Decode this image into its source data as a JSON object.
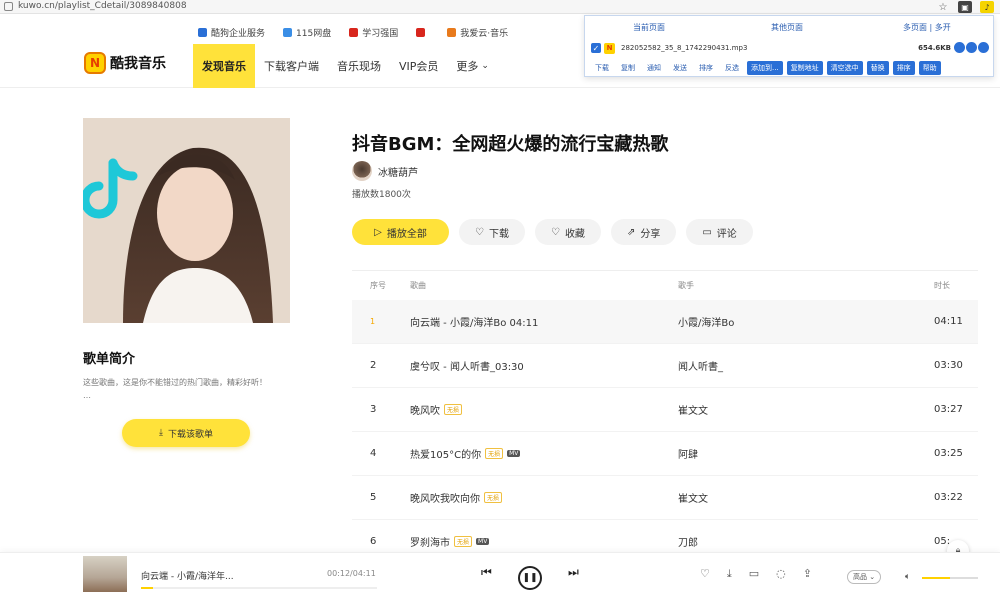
{
  "browser": {
    "url": "kuwo.cn/playlist_Cdetail/3089840808"
  },
  "bookmarks": [
    {
      "label": "酷狗企业服务",
      "color": "#2a6fd6"
    },
    {
      "label": "115网盘",
      "color": "#3a8ee6"
    },
    {
      "label": "学习强国",
      "color": "#d8261d"
    },
    {
      "label": "",
      "color": "#d8261d"
    },
    {
      "label": "我爱云·音乐",
      "color": "#e87a1c"
    }
  ],
  "header": {
    "logo_text": "酷我音乐",
    "nav": [
      {
        "label": "发现音乐",
        "active": true
      },
      {
        "label": "下载客户端",
        "active": false
      },
      {
        "label": "音乐现场",
        "active": false
      },
      {
        "label": "VIP会员",
        "active": false
      },
      {
        "label": "更多",
        "active": false
      }
    ]
  },
  "extension": {
    "tabs": [
      "当前页面",
      "其他页面",
      "多页面 | 多开"
    ],
    "file": {
      "name": "282052582_35_8_1742290431.mp3",
      "size": "654.6KB"
    },
    "links": [
      "下载",
      "复制",
      "通知",
      "发送",
      "排序",
      "反选"
    ],
    "buttons": [
      "添加到...",
      "复制地址",
      "清空选中",
      "替换",
      "排序",
      "帮助"
    ]
  },
  "playlist": {
    "title": "抖音BGM：全网超火爆的流行宝藏热歌",
    "author": "冰糖葫芦",
    "play_count": "播放数1800次",
    "intro_title": "歌单简介",
    "intro_text": "这些歌曲，这是你不能错过的热门歌曲，精彩好听！",
    "intro_text2": "…",
    "download_list_btn": "下载该歌单",
    "actions": {
      "play_all": "播放全部",
      "download": "下载",
      "favorite": "收藏",
      "share": "分享",
      "comment": "评论"
    }
  },
  "table": {
    "headers": {
      "no": "序号",
      "song": "歌曲",
      "singer": "歌手",
      "time": "时长"
    },
    "rows": [
      {
        "no": "1",
        "song": "向云端 - 小霞/海洋Bo 04:11",
        "singer": "小霞/海洋Bo",
        "time": "04:11",
        "vip": false,
        "mv": false
      },
      {
        "no": "2",
        "song": "虞兮叹 - 闻人听書_03:30",
        "singer": "闻人听書_",
        "time": "03:30",
        "vip": false,
        "mv": false
      },
      {
        "no": "3",
        "song": "晚风吹",
        "singer": "崔文文",
        "time": "03:27",
        "vip": true,
        "mv": false
      },
      {
        "no": "4",
        "song": "热爱105°C的你",
        "singer": "阿肆",
        "time": "03:25",
        "vip": true,
        "mv": true
      },
      {
        "no": "5",
        "song": "晚风吹我吹向你",
        "singer": "崔文文",
        "time": "03:22",
        "vip": true,
        "mv": false
      },
      {
        "no": "6",
        "song": "罗刹海市",
        "singer": "刀郎",
        "time": "05:",
        "vip": true,
        "mv": true
      }
    ],
    "tag_vip": "无损",
    "tag_mv": "MV"
  },
  "player": {
    "song": "向云端 - 小霞/海洋年...",
    "time": "00:12/04:11",
    "progress": 0.05,
    "quality": "高品",
    "volume": 0.5
  }
}
